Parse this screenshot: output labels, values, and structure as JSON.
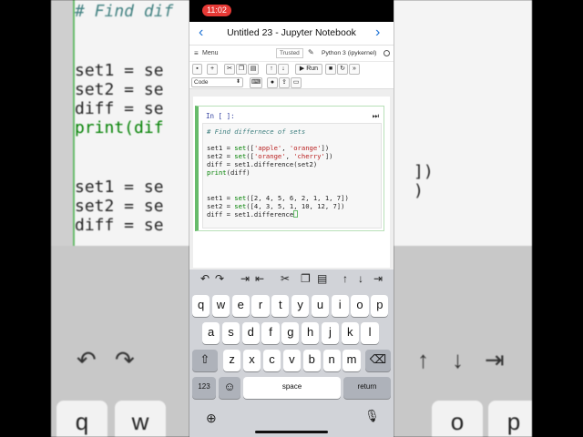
{
  "status": {
    "time": "11:02"
  },
  "nav": {
    "back_icon": "chevron-left-icon",
    "forward_icon": "chevron-right-icon"
  },
  "window": {
    "title": "Untitled 23 - Jupyter Notebook"
  },
  "menubar": {
    "menu_label": "Menu",
    "trusted_label": "Trusted",
    "kernel_label": "Python 3 (ipykernel)"
  },
  "toolbar": {
    "run_label": "Run",
    "cell_type": "Code"
  },
  "cell": {
    "prompt": "In [ ]:",
    "code": {
      "comment": "# Find differnece of sets",
      "l1a": "set1 = ",
      "l1b": "set",
      "l1c": "([",
      "l1d": "'apple'",
      "l1e": ", ",
      "l1f": "'orange'",
      "l1g": "])",
      "l2a": "set2 = ",
      "l2b": "set",
      "l2c": "([",
      "l2d": "'orange'",
      "l2e": ", ",
      "l2f": "'cherry'",
      "l2g": "])",
      "l3": "diff = set1.difference(set2)",
      "l4a": "print",
      "l4b": "(diff)",
      "l5a": "set1 = ",
      "l5b": "set",
      "l5c": "([2, 4, 5, 6, 2, 1, 1, 7])",
      "l6a": "set2 = ",
      "l6b": "set",
      "l6c": "([4, 3, 5, 1, 10, 12, 7])",
      "l7": "diff = set1.difference"
    }
  },
  "keyboard": {
    "row1": [
      "q",
      "w",
      "e",
      "r",
      "t",
      "y",
      "u",
      "i",
      "o",
      "p"
    ],
    "row2": [
      "a",
      "s",
      "d",
      "f",
      "g",
      "h",
      "j",
      "k",
      "l"
    ],
    "row3": [
      "z",
      "x",
      "c",
      "v",
      "b",
      "n",
      "m"
    ],
    "numbers_key": "123",
    "space_key": "space",
    "return_key": "return"
  },
  "background": {
    "line1": "# Find dif",
    "line2": "set1 = se",
    "line3": "set2 = se",
    "line4": "diff = se",
    "line5": "print(dif",
    "line6": "set1 = se",
    "line7": "set2 = se",
    "line8": "diff = se",
    "right1": "])",
    "right2": ")",
    "left_keys": [
      "q",
      "w"
    ],
    "right_keys": [
      "o",
      "p"
    ]
  }
}
